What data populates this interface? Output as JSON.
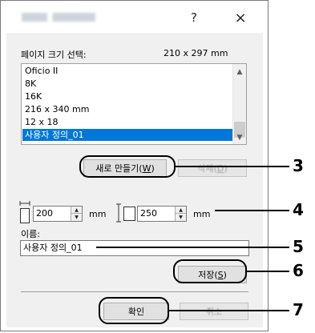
{
  "dialog": {
    "help_glyph": "?",
    "close_glyph": "×"
  },
  "page_size": {
    "label": "페이지 크기 선택:",
    "current": "210 x 297 mm",
    "items": [
      "Oficio II",
      "8K",
      "16K",
      "216 x 340 mm",
      "12 x 18",
      "사용자 정의_01"
    ],
    "selected_index": 5
  },
  "buttons": {
    "new_label": "새로 만들기(",
    "new_key": "W",
    "new_close": ")",
    "delete_label": "삭제(",
    "delete_key": "D",
    "delete_close": ")",
    "save_label": "저장(",
    "save_key": "S",
    "save_close": ")",
    "ok_label": "확인",
    "cancel_label": "취소"
  },
  "width": {
    "value": "200",
    "unit": "mm"
  },
  "height": {
    "value": "250",
    "unit": "mm"
  },
  "name": {
    "label": "이름:",
    "value": "사용자 정의_01"
  },
  "callouts": [
    "3",
    "4",
    "5",
    "6",
    "7"
  ]
}
